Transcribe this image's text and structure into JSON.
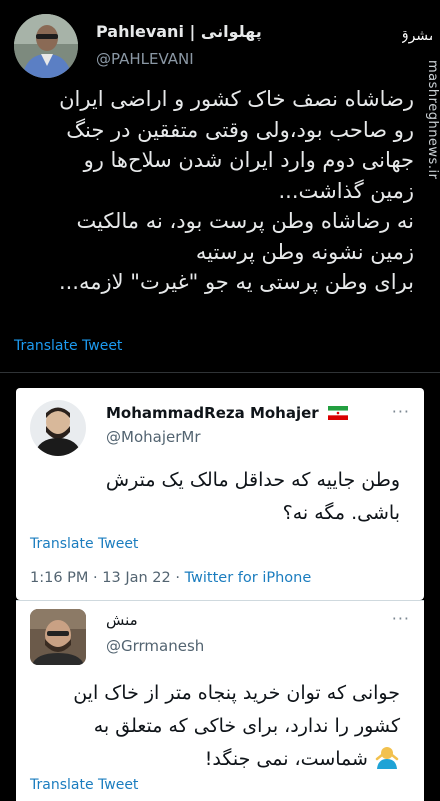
{
  "main_tweet": {
    "display_name": "Pahlevani | پهلوانی",
    "handle": "@PAHLEVANI",
    "text_lines": [
      "رضاشاه نصف خاک کشور و اراضی ایران",
      "رو صاحب بود،ولی وقتی متفقین در جنگ",
      "جهانی دوم وارد ایران شدن سلاح‌ها رو",
      "زمین گذاشت...",
      "نه رضاشاه وطن پرست بود، نه مالکیت",
      "زمین نشونه وطن پرستیه",
      "برای وطن پرستی یه جو \"غیرت\" لازمه..."
    ],
    "translate_label": "Translate Tweet"
  },
  "watermark": {
    "logo_text": "مشرق",
    "site": "mashreghnews.ir"
  },
  "quoted_tweet_1": {
    "display_name": "MohammadReza Mohajer",
    "handle": "@MohajerMr",
    "text_lines": [
      "وطن جاییه که حداقل مالک یک مترش",
      "باشی. مگه نه؟"
    ],
    "translate_label": "Translate Tweet",
    "time": "1:16 PM",
    "date": "13 Jan 22",
    "source": "Twitter for iPhone",
    "more_label": "···"
  },
  "quoted_tweet_2": {
    "display_name": "منش",
    "handle": "@Grrmanesh",
    "text_lines": [
      "جوانی که توان خرید پنجاه متر از خاک این",
      "کشور را ندارد، برای خاکی که متعلق به",
      "شماست، نمی جنگد!"
    ],
    "translate_label": "Translate Tweet",
    "more_label": "···"
  },
  "colors": {
    "background": "#000000",
    "link_blue": "#1d9bf0",
    "card_background": "#ffffff"
  },
  "icons": [
    "avatar-photo",
    "mashregh-logo",
    "iran-flag-icon",
    "shrug-emoji-icon"
  ]
}
